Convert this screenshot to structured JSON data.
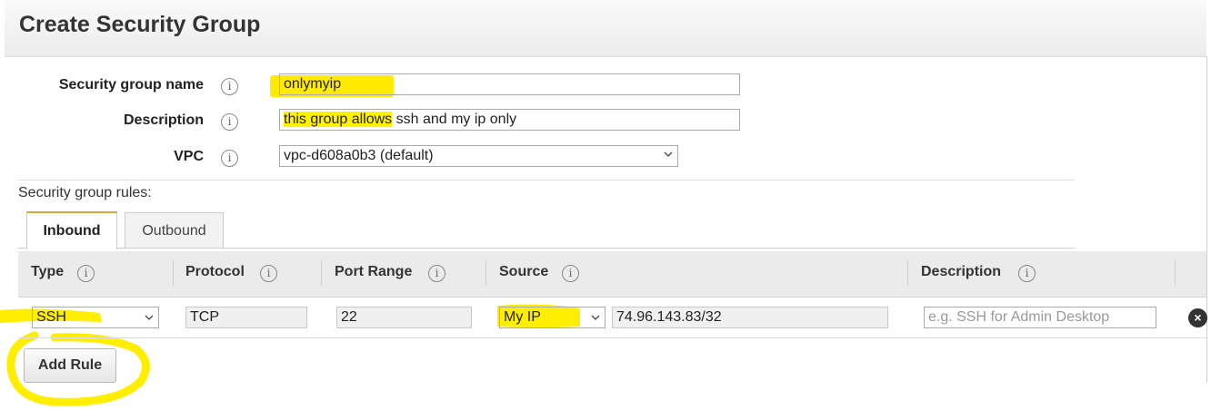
{
  "header": {
    "title": "Create Security Group"
  },
  "form": {
    "name_label": "Security group name",
    "name_value": "onlymyip",
    "description_label": "Description",
    "description_value_highlighted": "this group allows",
    "description_value_rest": " ssh and my ip only",
    "vpc_label": "VPC",
    "vpc_value": "vpc-d608a0b3 (default)",
    "info_glyph": "i"
  },
  "rules": {
    "section_label": "Security group rules:",
    "tabs": [
      {
        "label": "Inbound",
        "active": true
      },
      {
        "label": "Outbound",
        "active": false
      }
    ],
    "columns": {
      "type": "Type",
      "protocol": "Protocol",
      "port_range": "Port Range",
      "source": "Source",
      "description": "Description"
    },
    "row": {
      "type": "SSH",
      "protocol": "TCP",
      "port_range": "22",
      "source_select": "My IP",
      "source_cidr": "74.96.143.83/32",
      "description_placeholder": "e.g. SSH for Admin Desktop"
    },
    "add_rule_label": "Add Rule",
    "remove_icon": "×"
  },
  "colors": {
    "highlight": "#ffea00",
    "tab_accent": "#e6a23c"
  }
}
